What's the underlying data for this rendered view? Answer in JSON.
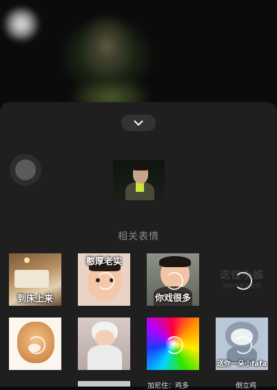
{
  "section_title": "相关表情",
  "stickers": [
    {
      "caption": "到床上来"
    },
    {
      "caption": "憨厚老实"
    },
    {
      "caption": "你戏很多"
    },
    {
      "caption": "这位小姊",
      "subcaption": "请你不要骚扰我"
    },
    {
      "caption": ""
    },
    {
      "caption": ""
    },
    {
      "caption": ""
    },
    {
      "caption": "送你一朵小fafa"
    }
  ],
  "partial_row_text": [
    "加尼住：鸡多",
    "倒立鸡"
  ],
  "colors": {
    "sheet": "#1f1f1f",
    "accent": "#c9e640"
  }
}
